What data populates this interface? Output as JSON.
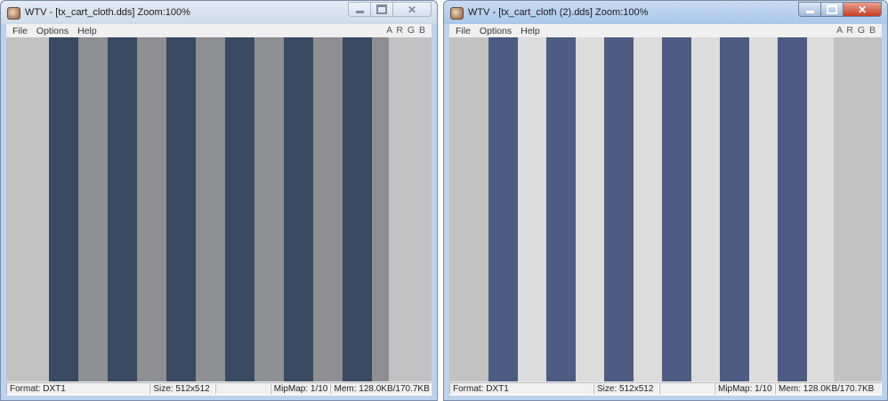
{
  "colors": {
    "left_dark_stripe": "#394a63",
    "left_light_stripe": "#8d8f92",
    "right_dark_stripe": "#4c5c82",
    "right_light_stripe": "#dcdcdc",
    "viewport_bg": "#c2c2c2"
  },
  "windows": [
    {
      "id": "left",
      "title": "WTV - [tx_cart_cloth.dds] Zoom:100%",
      "menu": [
        "File",
        "Options",
        "Help"
      ],
      "channels": "A R G B",
      "status": {
        "format": "Format: DXT1",
        "size": "Size: 512x512",
        "mipmap": "MipMap: 1/10",
        "mem": "Mem: 128.0KB/170.7KB"
      }
    },
    {
      "id": "right",
      "title": "WTV - [tx_cart_cloth (2).dds] Zoom:100%",
      "menu": [
        "File",
        "Options",
        "Help"
      ],
      "channels": "A R G B",
      "status": {
        "format": "Format: DXT1",
        "size": "Size: 512x512",
        "mipmap": "MipMap: 1/10",
        "mem": "Mem: 128.0KB/170.7KB"
      }
    }
  ]
}
